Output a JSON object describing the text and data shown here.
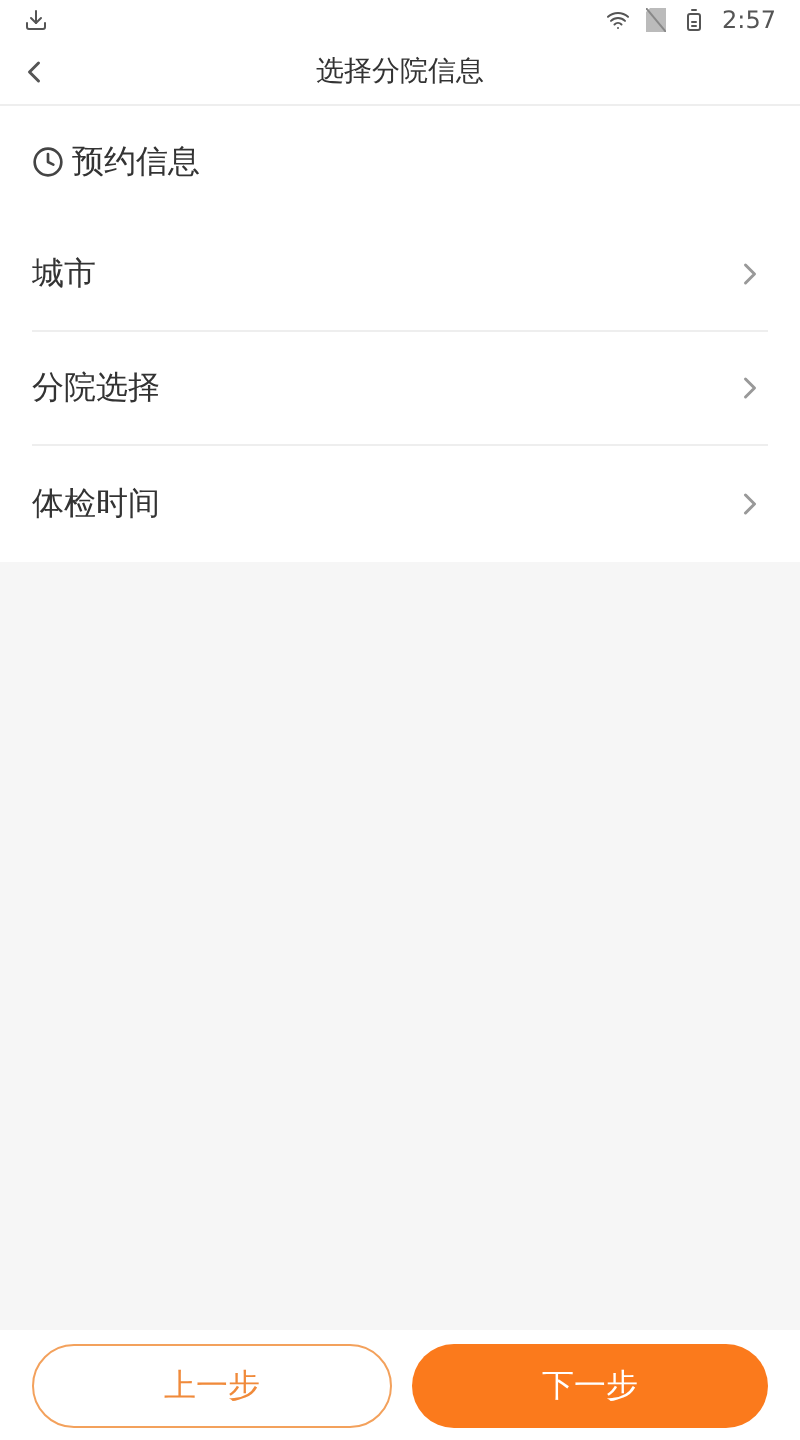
{
  "status_bar": {
    "time": "2:57"
  },
  "header": {
    "title": "选择分院信息"
  },
  "section": {
    "title": "预约信息"
  },
  "rows": [
    {
      "label": "城市"
    },
    {
      "label": "分院选择"
    },
    {
      "label": "体检时间"
    }
  ],
  "buttons": [
    {
      "label": "上一步",
      "kind": "outline"
    },
    {
      "label": "下一步",
      "kind": "filled"
    }
  ]
}
